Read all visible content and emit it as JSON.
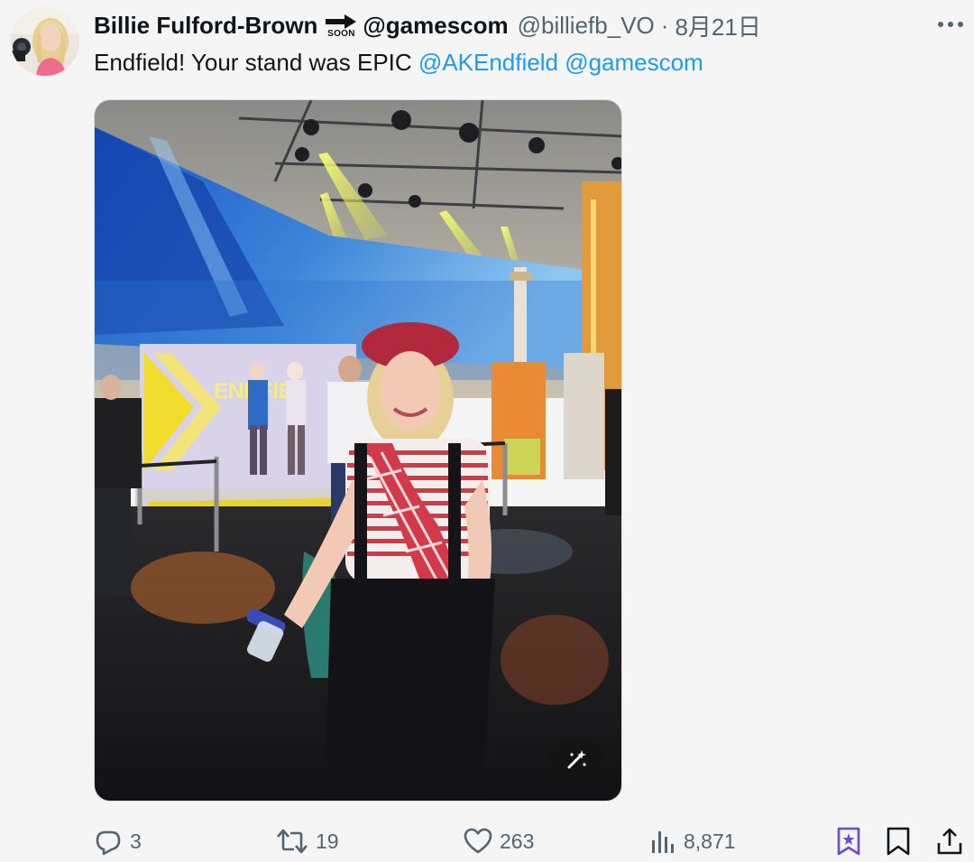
{
  "author": {
    "display_name": "Billie Fulford-Brown",
    "name_suffix": "@gamescom",
    "emoji_text": "SOON",
    "handle": "@billiefb_VO",
    "separator": "·",
    "date": "8月21日"
  },
  "tweet": {
    "text": "Endfield! Your stand was EPIC",
    "mention_1": "@AKEndfield",
    "mention_2": "@gamescom"
  },
  "media": {
    "sign_text": "ENDFIE"
  },
  "stats": {
    "replies": "3",
    "retweets": "19",
    "likes": "263",
    "views": "8,871"
  },
  "icons": {
    "avatar": "avatar-photo",
    "soon": "soon-arrow-icon",
    "more": "more-dots-icon",
    "magic": "magic-wand-icon",
    "reply": "reply-icon",
    "retweet": "retweet-icon",
    "like": "heart-icon",
    "views": "views-icon",
    "grok": "grok-icon",
    "bookmark": "bookmark-icon",
    "share": "share-icon"
  },
  "colors": {
    "background": "#f5f5f5",
    "text": "#0f1419",
    "secondary": "#536471",
    "link": "#1d9bf0",
    "grok_accent": "#6c4ad8"
  }
}
